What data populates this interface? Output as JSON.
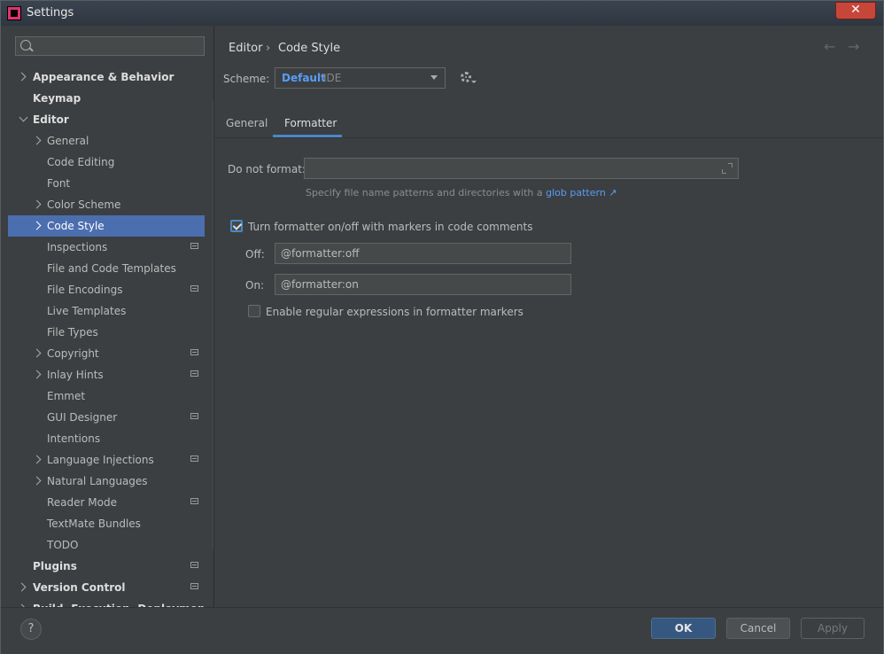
{
  "window": {
    "title": "Settings",
    "close": "✕"
  },
  "search": {
    "placeholder": ""
  },
  "sidebar": {
    "items": [
      {
        "label": "Appearance & Behavior"
      },
      {
        "label": "Keymap"
      },
      {
        "label": "Editor"
      },
      {
        "label": "General"
      },
      {
        "label": "Code Editing"
      },
      {
        "label": "Font"
      },
      {
        "label": "Color Scheme"
      },
      {
        "label": "Code Style"
      },
      {
        "label": "Inspections"
      },
      {
        "label": "File and Code Templates"
      },
      {
        "label": "File Encodings"
      },
      {
        "label": "Live Templates"
      },
      {
        "label": "File Types"
      },
      {
        "label": "Copyright"
      },
      {
        "label": "Inlay Hints"
      },
      {
        "label": "Emmet"
      },
      {
        "label": "GUI Designer"
      },
      {
        "label": "Intentions"
      },
      {
        "label": "Language Injections"
      },
      {
        "label": "Natural Languages"
      },
      {
        "label": "Reader Mode"
      },
      {
        "label": "TextMate Bundles"
      },
      {
        "label": "TODO"
      },
      {
        "label": "Plugins"
      },
      {
        "label": "Version Control"
      },
      {
        "label": "Build, Execution, Deployment"
      }
    ]
  },
  "breadcrumb": {
    "parent": "Editor",
    "sep": "›",
    "current": "Code Style"
  },
  "nav": {
    "back": "←",
    "forward": "→"
  },
  "scheme": {
    "label": "Scheme:",
    "name": "Default",
    "sub": "IDE"
  },
  "tabs": [
    {
      "label": "General"
    },
    {
      "label": "Formatter"
    }
  ],
  "formatter": {
    "do_not_format_label": "Do not format:",
    "do_not_format_value": "",
    "hint_prefix": "Specify file name patterns and directories with a ",
    "hint_link": "glob pattern ↗",
    "toggle_label": "Turn formatter on/off with markers in code comments",
    "toggle_checked": true,
    "off_label": "Off:",
    "off_value": "@formatter:off",
    "on_label": "On:",
    "on_value": "@formatter:on",
    "regex_label": "Enable regular expressions in formatter markers",
    "regex_checked": false
  },
  "footer": {
    "help": "?",
    "ok": "OK",
    "cancel": "Cancel",
    "apply": "Apply"
  },
  "colors": {
    "accent": "#4b6eaf",
    "link": "#589df6",
    "background": "#3c3f41"
  }
}
